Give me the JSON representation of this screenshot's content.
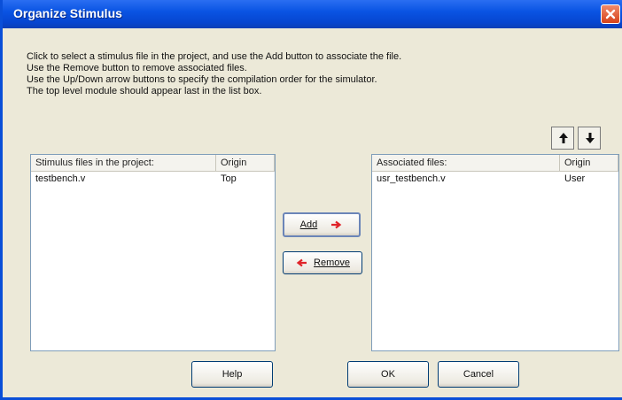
{
  "window": {
    "title": "Organize Stimulus"
  },
  "instructions": [
    "Click to select a stimulus file in the project, and use the Add button to associate the file.",
    "Use the Remove button to remove associated files.",
    "Use the Up/Down arrow buttons to specify the compilation order for the simulator.",
    "The top level module should appear last in the list box."
  ],
  "left_list": {
    "columns": [
      "Stimulus files in the project:",
      "Origin"
    ],
    "rows": [
      {
        "file": "testbench.v",
        "origin": "Top"
      }
    ]
  },
  "right_list": {
    "columns": [
      "Associated files:",
      "Origin"
    ],
    "rows": [
      {
        "file": "usr_testbench.v",
        "origin": "User"
      }
    ]
  },
  "buttons": {
    "add": "Add",
    "remove": "Remove",
    "help": "Help",
    "ok": "OK",
    "cancel": "Cancel"
  },
  "icons": {
    "up": "arrow-up-icon",
    "down": "arrow-down-icon",
    "close": "close-icon"
  },
  "colors": {
    "titlebar": "#0a54e3",
    "arrow_accent": "#e0242a",
    "close_button": "#d6421a"
  }
}
